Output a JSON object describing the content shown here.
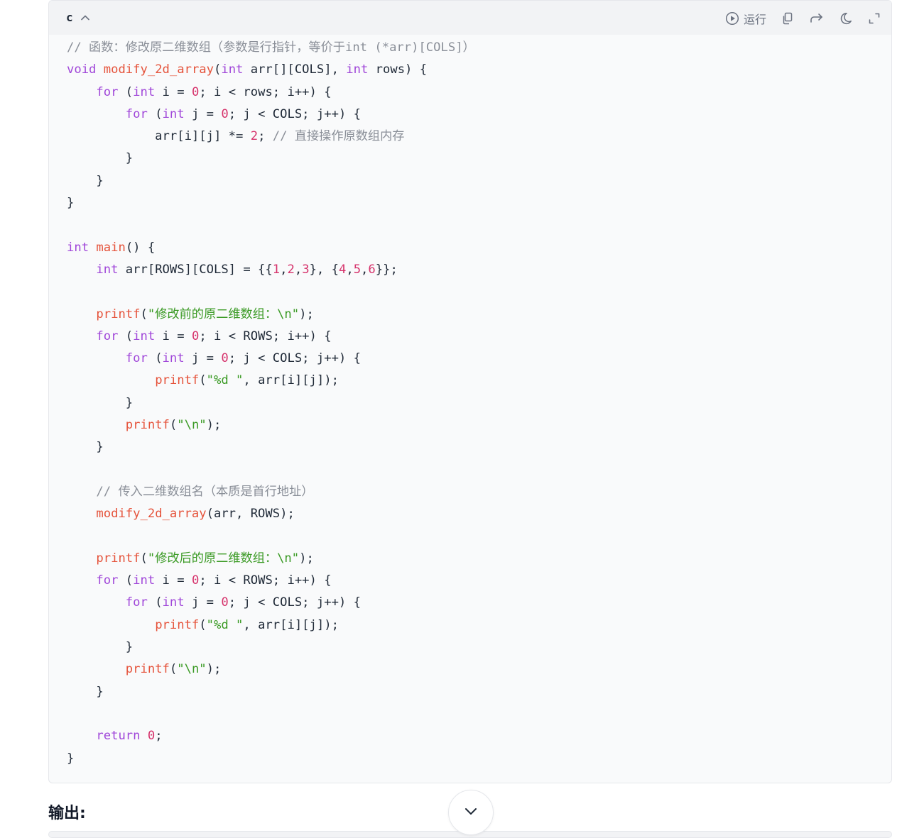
{
  "code_block": {
    "language": "c",
    "toolbar": {
      "run_label": "运行",
      "icons": [
        "play-circle-icon",
        "copy-icon",
        "share-icon",
        "dark-mode-icon",
        "expand-icon"
      ]
    },
    "lines": [
      [
        {
          "t": "comment",
          "v": "// 函数：修改原二维数组（参数是行指针，等价于int (*arr)[COLS]）"
        }
      ],
      [
        {
          "t": "keyword",
          "v": "void"
        },
        {
          "t": "plain",
          "v": " "
        },
        {
          "t": "func",
          "v": "modify_2d_array"
        },
        {
          "t": "plain",
          "v": "("
        },
        {
          "t": "keyword",
          "v": "int"
        },
        {
          "t": "plain",
          "v": " arr[][COLS], "
        },
        {
          "t": "keyword",
          "v": "int"
        },
        {
          "t": "plain",
          "v": " rows) {"
        }
      ],
      [
        {
          "t": "plain",
          "v": "    "
        },
        {
          "t": "keyword",
          "v": "for"
        },
        {
          "t": "plain",
          "v": " ("
        },
        {
          "t": "keyword",
          "v": "int"
        },
        {
          "t": "plain",
          "v": " i = "
        },
        {
          "t": "number",
          "v": "0"
        },
        {
          "t": "plain",
          "v": "; i < rows; i++) {"
        }
      ],
      [
        {
          "t": "plain",
          "v": "        "
        },
        {
          "t": "keyword",
          "v": "for"
        },
        {
          "t": "plain",
          "v": " ("
        },
        {
          "t": "keyword",
          "v": "int"
        },
        {
          "t": "plain",
          "v": " j = "
        },
        {
          "t": "number",
          "v": "0"
        },
        {
          "t": "plain",
          "v": "; j < COLS; j++) {"
        }
      ],
      [
        {
          "t": "plain",
          "v": "            arr[i][j] *= "
        },
        {
          "t": "number",
          "v": "2"
        },
        {
          "t": "plain",
          "v": "; "
        },
        {
          "t": "comment",
          "v": "// 直接操作原数组内存"
        }
      ],
      [
        {
          "t": "plain",
          "v": "        }"
        }
      ],
      [
        {
          "t": "plain",
          "v": "    }"
        }
      ],
      [
        {
          "t": "plain",
          "v": "}"
        }
      ],
      [],
      [
        {
          "t": "keyword",
          "v": "int"
        },
        {
          "t": "plain",
          "v": " "
        },
        {
          "t": "func",
          "v": "main"
        },
        {
          "t": "plain",
          "v": "() {"
        }
      ],
      [
        {
          "t": "plain",
          "v": "    "
        },
        {
          "t": "keyword",
          "v": "int"
        },
        {
          "t": "plain",
          "v": " arr[ROWS][COLS] = {{"
        },
        {
          "t": "number",
          "v": "1"
        },
        {
          "t": "plain",
          "v": ","
        },
        {
          "t": "number",
          "v": "2"
        },
        {
          "t": "plain",
          "v": ","
        },
        {
          "t": "number",
          "v": "3"
        },
        {
          "t": "plain",
          "v": "}, {"
        },
        {
          "t": "number",
          "v": "4"
        },
        {
          "t": "plain",
          "v": ","
        },
        {
          "t": "number",
          "v": "5"
        },
        {
          "t": "plain",
          "v": ","
        },
        {
          "t": "number",
          "v": "6"
        },
        {
          "t": "plain",
          "v": "}};"
        }
      ],
      [],
      [
        {
          "t": "plain",
          "v": "    "
        },
        {
          "t": "func",
          "v": "printf"
        },
        {
          "t": "plain",
          "v": "("
        },
        {
          "t": "string",
          "v": "\"修改前的原二维数组：\\n\""
        },
        {
          "t": "plain",
          "v": ");"
        }
      ],
      [
        {
          "t": "plain",
          "v": "    "
        },
        {
          "t": "keyword",
          "v": "for"
        },
        {
          "t": "plain",
          "v": " ("
        },
        {
          "t": "keyword",
          "v": "int"
        },
        {
          "t": "plain",
          "v": " i = "
        },
        {
          "t": "number",
          "v": "0"
        },
        {
          "t": "plain",
          "v": "; i < ROWS; i++) {"
        }
      ],
      [
        {
          "t": "plain",
          "v": "        "
        },
        {
          "t": "keyword",
          "v": "for"
        },
        {
          "t": "plain",
          "v": " ("
        },
        {
          "t": "keyword",
          "v": "int"
        },
        {
          "t": "plain",
          "v": " j = "
        },
        {
          "t": "number",
          "v": "0"
        },
        {
          "t": "plain",
          "v": "; j < COLS; j++) {"
        }
      ],
      [
        {
          "t": "plain",
          "v": "            "
        },
        {
          "t": "func",
          "v": "printf"
        },
        {
          "t": "plain",
          "v": "("
        },
        {
          "t": "string",
          "v": "\"%d \""
        },
        {
          "t": "plain",
          "v": ", arr[i][j]);"
        }
      ],
      [
        {
          "t": "plain",
          "v": "        }"
        }
      ],
      [
        {
          "t": "plain",
          "v": "        "
        },
        {
          "t": "func",
          "v": "printf"
        },
        {
          "t": "plain",
          "v": "("
        },
        {
          "t": "string",
          "v": "\"\\n\""
        },
        {
          "t": "plain",
          "v": ");"
        }
      ],
      [
        {
          "t": "plain",
          "v": "    }"
        }
      ],
      [],
      [
        {
          "t": "plain",
          "v": "    "
        },
        {
          "t": "comment",
          "v": "// 传入二维数组名（本质是首行地址）"
        }
      ],
      [
        {
          "t": "plain",
          "v": "    "
        },
        {
          "t": "func",
          "v": "modify_2d_array"
        },
        {
          "t": "plain",
          "v": "(arr, ROWS);"
        }
      ],
      [],
      [
        {
          "t": "plain",
          "v": "    "
        },
        {
          "t": "func",
          "v": "printf"
        },
        {
          "t": "plain",
          "v": "("
        },
        {
          "t": "string",
          "v": "\"修改后的原二维数组：\\n\""
        },
        {
          "t": "plain",
          "v": ");"
        }
      ],
      [
        {
          "t": "plain",
          "v": "    "
        },
        {
          "t": "keyword",
          "v": "for"
        },
        {
          "t": "plain",
          "v": " ("
        },
        {
          "t": "keyword",
          "v": "int"
        },
        {
          "t": "plain",
          "v": " i = "
        },
        {
          "t": "number",
          "v": "0"
        },
        {
          "t": "plain",
          "v": "; i < ROWS; i++) {"
        }
      ],
      [
        {
          "t": "plain",
          "v": "        "
        },
        {
          "t": "keyword",
          "v": "for"
        },
        {
          "t": "plain",
          "v": " ("
        },
        {
          "t": "keyword",
          "v": "int"
        },
        {
          "t": "plain",
          "v": " j = "
        },
        {
          "t": "number",
          "v": "0"
        },
        {
          "t": "plain",
          "v": "; j < COLS; j++) {"
        }
      ],
      [
        {
          "t": "plain",
          "v": "            "
        },
        {
          "t": "func",
          "v": "printf"
        },
        {
          "t": "plain",
          "v": "("
        },
        {
          "t": "string",
          "v": "\"%d \""
        },
        {
          "t": "plain",
          "v": ", arr[i][j]);"
        }
      ],
      [
        {
          "t": "plain",
          "v": "        }"
        }
      ],
      [
        {
          "t": "plain",
          "v": "        "
        },
        {
          "t": "func",
          "v": "printf"
        },
        {
          "t": "plain",
          "v": "("
        },
        {
          "t": "string",
          "v": "\"\\n\""
        },
        {
          "t": "plain",
          "v": ");"
        }
      ],
      [
        {
          "t": "plain",
          "v": "    }"
        }
      ],
      [],
      [
        {
          "t": "plain",
          "v": "    "
        },
        {
          "t": "keyword",
          "v": "return"
        },
        {
          "t": "plain",
          "v": " "
        },
        {
          "t": "number",
          "v": "0"
        },
        {
          "t": "plain",
          "v": ";"
        }
      ],
      [
        {
          "t": "plain",
          "v": "}"
        }
      ]
    ]
  },
  "output_heading": "输出:",
  "scroll_button_icon": "chevron-down-icon",
  "colors": {
    "keyword": "#a046d9",
    "function": "#e5533b",
    "number": "#d6336c",
    "string": "#3a9a24",
    "comment": "#8a8f98",
    "plain": "#1f2937",
    "code_background": "#f9fafb",
    "header_background": "#f2f3f5"
  }
}
